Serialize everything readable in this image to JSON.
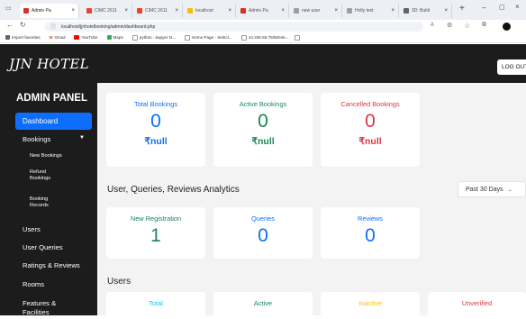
{
  "browser": {
    "tabs": [
      {
        "label": "Admin Pa",
        "active": true,
        "color": "#d93025"
      },
      {
        "label": "CIMC 2611",
        "color": "#ea4335"
      },
      {
        "label": "CIMC 2611",
        "color": "#ea4335"
      },
      {
        "label": "localhost",
        "color": "#fbbc04"
      },
      {
        "label": "Admin Pa",
        "color": "#d93025"
      },
      {
        "label": "new user",
        "color": "#9aa0a6"
      },
      {
        "label": "Holly test",
        "color": "#9aa0a6"
      },
      {
        "label": "3D: Build",
        "color": "#5f6368"
      }
    ],
    "url": "localhost/jjnhotelbooking/admin/dashboard.php",
    "bookmarks": [
      "Import favorites",
      "Gmail",
      "YouTube",
      "Maps",
      "python - kapyer N...",
      "Home Page - Select...",
      "44.226.55.75/5604e..."
    ]
  },
  "header": {
    "brand": "JJN HOTEL",
    "logout_label": "LOG OUT"
  },
  "sidebar": {
    "title": "ADMIN PANEL",
    "items": [
      {
        "label": "Dashboard"
      },
      {
        "label": "Bookings"
      },
      {
        "label": "New Bookings"
      },
      {
        "label": "Refund Bookings"
      },
      {
        "label": "Booking Records"
      },
      {
        "label": "Users"
      },
      {
        "label": "User Queries"
      },
      {
        "label": "Ratings & Reviews"
      },
      {
        "label": "Rooms"
      },
      {
        "label": "Features & Facilities"
      }
    ]
  },
  "bookings": [
    {
      "label": "Total Bookings",
      "count": "0",
      "amount": "₹null",
      "color": "#0d6efd"
    },
    {
      "label": "Active Bookings",
      "count": "0",
      "amount": "₹null",
      "color": "#198754"
    },
    {
      "label": "Cancelled Bookings",
      "count": "0",
      "amount": "₹null",
      "color": "#dc3545"
    }
  ],
  "analytics": {
    "title": "User, Queries, Reviews Analytics",
    "period": "Past 30 Days",
    "cards": [
      {
        "label": "New Registration",
        "count": "1",
        "color": "#198754"
      },
      {
        "label": "Queries",
        "count": "0",
        "color": "#0d6efd"
      },
      {
        "label": "Reviews",
        "count": "0",
        "color": "#0d6efd"
      }
    ]
  },
  "users": {
    "title": "Users",
    "cards": [
      {
        "label": "Total",
        "color": "#0dcaf0"
      },
      {
        "label": "Active",
        "color": "#198754"
      },
      {
        "label": "Inactive",
        "color": "#ffc107"
      },
      {
        "label": "Unverified",
        "color": "#dc3545"
      }
    ]
  }
}
